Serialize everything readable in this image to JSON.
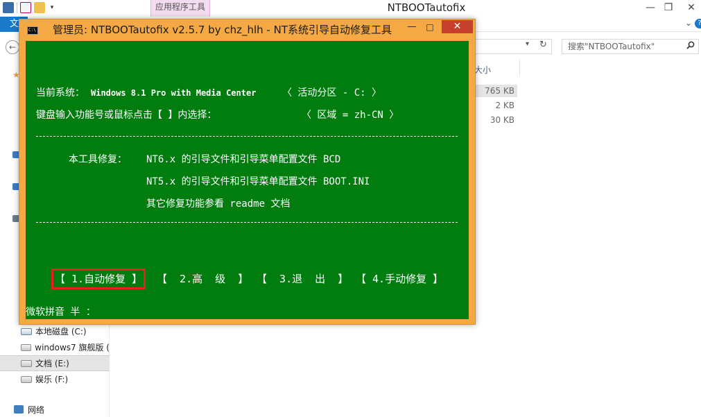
{
  "explorer": {
    "title": "NTBOOTautofix",
    "context_tab": "应用程序工具",
    "file_tab": "文",
    "search_placeholder": "搜索\"NTBOOTautofix\"",
    "column_size_label": "大小",
    "sizes": [
      "765 KB",
      "2 KB",
      "30 KB"
    ],
    "window_controls": {
      "minimize": "—",
      "maximize": "❐",
      "close": "✕"
    },
    "sidebar": {
      "drives": [
        {
          "label": "本地磁盘 (C:)",
          "icon": "windows-drive-icon"
        },
        {
          "label": "windows7 旗舰版 (",
          "icon": "drive-icon"
        },
        {
          "label": "文档 (E:)",
          "icon": "drive-icon",
          "selected": true
        },
        {
          "label": "娱乐 (F:)",
          "icon": "drive-icon"
        }
      ],
      "network": "网络"
    }
  },
  "console": {
    "title": "管理员:  NTBOOTautofix v2.5.7 by chz_hlh - NT系统引导自动修复工具",
    "icon_text": "C:\\",
    "controls": {
      "minimize": "—",
      "maximize": "□",
      "close": "✕"
    },
    "line_system_label": "当前系统：",
    "line_system_value": "Windows 8.1 Pro with Media Center",
    "line_partition": "〈 活动分区 - C: 〉",
    "line_prompt": "键盘输入功能号或鼠标点击【 】内选择：",
    "line_region": "〈 区域 = zh-CN 〉",
    "repair_label": "本工具修复：",
    "repair_nt6": "NT6.x 的引导文件和引导菜单配置文件 BCD",
    "repair_nt5": "NT5.x 的引导文件和引导菜单配置文件 BOOT.INI",
    "repair_other": "其它修复功能参看 readme 文档",
    "menu": [
      {
        "label": "【 1.自动修复 】",
        "highlighted": true
      },
      {
        "label": "【  2.高  级  】",
        "highlighted": false
      },
      {
        "label": "【  3.退  出  】",
        "highlighted": false
      },
      {
        "label": "【 4.手动修复 】",
        "highlighted": false
      }
    ],
    "ime_status": "微软拼音 半 ：",
    "colors": {
      "background": "#007d0e",
      "text": "#ffffff",
      "frame": "#f5a944",
      "highlight": "#e8201d"
    }
  }
}
